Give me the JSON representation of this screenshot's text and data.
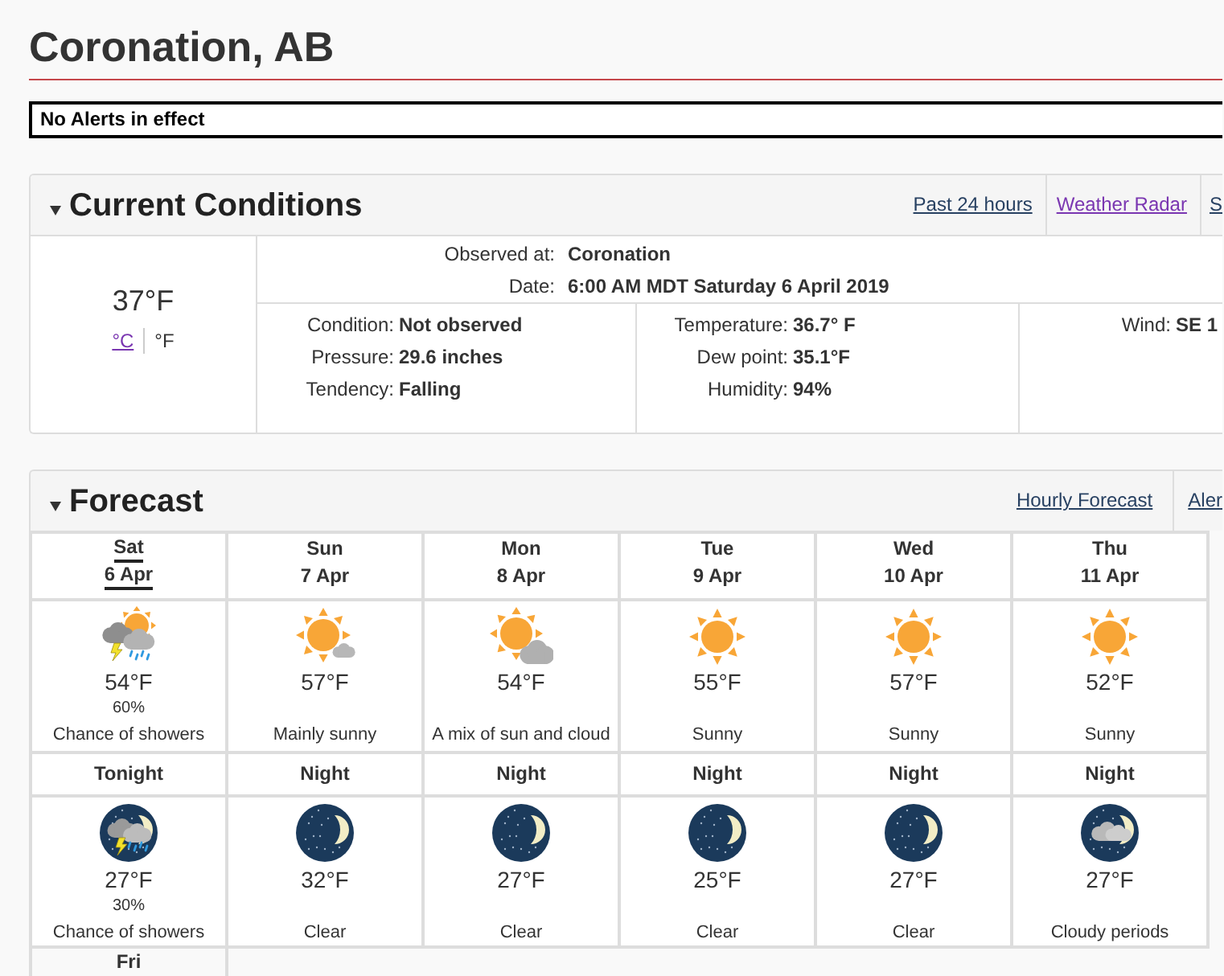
{
  "page": {
    "title": "Coronation, AB"
  },
  "alert_banner": {
    "text": "No Alerts in effect"
  },
  "current_conditions": {
    "title": "Current Conditions",
    "expanded": true,
    "links": [
      {
        "label": "Past 24 hours",
        "visited": false
      },
      {
        "label": "Weather Radar",
        "visited": true
      },
      {
        "label": "S",
        "visited": false
      }
    ],
    "temperature": "37°F",
    "units": [
      {
        "label": "°C",
        "selected": false
      },
      {
        "label": "°F",
        "selected": true
      }
    ],
    "observation": [
      {
        "label": "Observed at:",
        "value": "Coronation"
      },
      {
        "label": "Date:",
        "value": "6:00 AM MDT Saturday 6 April 2019"
      }
    ],
    "details": [
      {
        "rows": [
          {
            "label": "Condition:",
            "value": "Not observed"
          },
          {
            "label": "Pressure:",
            "value": "29.6 inches"
          },
          {
            "label": "Tendency:",
            "value": "Falling"
          }
        ]
      },
      {
        "rows": [
          {
            "label": "Temperature:",
            "value": "36.7° F"
          },
          {
            "label": "Dew point:",
            "value": "35.1°F"
          },
          {
            "label": "Humidity:",
            "value": "94%"
          }
        ]
      },
      {
        "rows": [
          {
            "label": "Wind:",
            "value": "SE 1"
          }
        ]
      }
    ]
  },
  "forecast": {
    "title": "Forecast",
    "expanded": true,
    "links": [
      {
        "label": "Hourly Forecast",
        "visited": false
      },
      {
        "label": "Aler",
        "visited": false
      }
    ],
    "days": [
      {
        "day": "Sat",
        "date": "6 Apr",
        "selected": true,
        "kind": "showers",
        "temperature": "54°F",
        "pop": "60%",
        "summary": "Chance of showers"
      },
      {
        "day": "Sun",
        "date": "7 Apr",
        "selected": false,
        "kind": "partsun",
        "temperature": "57°F",
        "summary": "Mainly sunny"
      },
      {
        "day": "Mon",
        "date": "8 Apr",
        "selected": false,
        "kind": "mixed",
        "temperature": "54°F",
        "summary": "A mix of sun and cloud"
      },
      {
        "day": "Tue",
        "date": "9 Apr",
        "selected": false,
        "kind": "sunny",
        "temperature": "55°F",
        "summary": "Sunny"
      },
      {
        "day": "Wed",
        "date": "10 Apr",
        "selected": false,
        "kind": "sunny",
        "temperature": "57°F",
        "summary": "Sunny"
      },
      {
        "day": "Thu",
        "date": "11 Apr",
        "selected": false,
        "kind": "sunny",
        "temperature": "52°F",
        "summary": "Sunny"
      }
    ],
    "nights": [
      {
        "label": "Tonight",
        "kind": "showers",
        "temperature": "27°F",
        "pop": "30%",
        "summary": "Chance of showers"
      },
      {
        "label": "Night",
        "kind": "clear",
        "temperature": "32°F",
        "summary": "Clear"
      },
      {
        "label": "Night",
        "kind": "clear",
        "temperature": "27°F",
        "summary": "Clear"
      },
      {
        "label": "Night",
        "kind": "clear",
        "temperature": "25°F",
        "summary": "Clear"
      },
      {
        "label": "Night",
        "kind": "clear",
        "temperature": "27°F",
        "summary": "Clear"
      },
      {
        "label": "Night",
        "kind": "cloudy",
        "temperature": "27°F",
        "summary": "Cloudy periods"
      }
    ],
    "next_days": [
      {
        "day": "Fri",
        "selected": false
      }
    ]
  }
}
